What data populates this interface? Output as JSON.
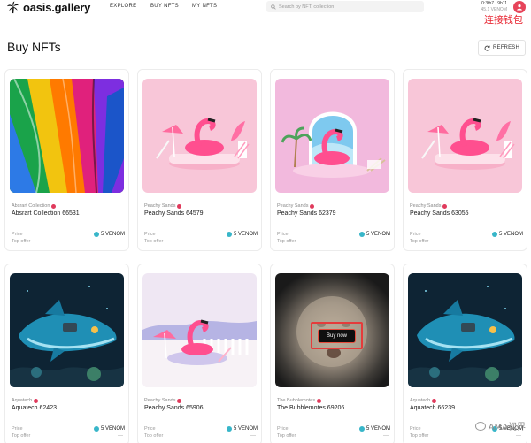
{
  "header": {
    "logo_text": "oasis.gallery",
    "nav": [
      {
        "label": "EXPLORE"
      },
      {
        "label": "BUY NFTS"
      },
      {
        "label": "MY NFTS"
      }
    ],
    "search_placeholder": "Search by NFT, collection",
    "wallet_address": "0:3fb7...9b11",
    "wallet_balance": "45.1 VENOM",
    "annotation": "连接钱包"
  },
  "page": {
    "title": "Buy NFTs",
    "refresh_label": "REFRESH"
  },
  "card_labels": {
    "price": "Price",
    "top_offer": "Top offer",
    "top_offer_value": "---",
    "buy_now": "Buy now"
  },
  "cards": [
    {
      "collection": "Absrart Collection",
      "name": "Absrart Collection 66531",
      "price": "5 VENOM",
      "art": "rainbow"
    },
    {
      "collection": "Peachy Sands",
      "name": "Peachy Sands 64579",
      "price": "5 VENOM",
      "art": "flamingo-pink"
    },
    {
      "collection": "Peachy Sands",
      "name": "Peachy Sands 62379",
      "price": "5 VENOM",
      "art": "flamingo-arch"
    },
    {
      "collection": "Peachy Sands",
      "name": "Peachy Sands 63055",
      "price": "5 VENOM",
      "art": "flamingo-pink"
    },
    {
      "collection": "Aquatech",
      "name": "Aquatech 62423",
      "price": "5 VENOM",
      "art": "whale"
    },
    {
      "collection": "Peachy Sands",
      "name": "Peachy Sands 65906",
      "price": "5 VENOM",
      "art": "flamingo-lilac"
    },
    {
      "collection": "The Bubblemotes",
      "name": "The Bubblemotes 69206",
      "price": "5 VENOM",
      "art": "bubble"
    },
    {
      "collection": "Aquatech",
      "name": "Aquatech 66239",
      "price": "5 VENOM",
      "art": "whale"
    }
  ],
  "watermark": "AMA视界",
  "colors": {
    "accent_red": "#e8232f",
    "verified": "#e03a5c",
    "venom": "#38b6c9"
  }
}
